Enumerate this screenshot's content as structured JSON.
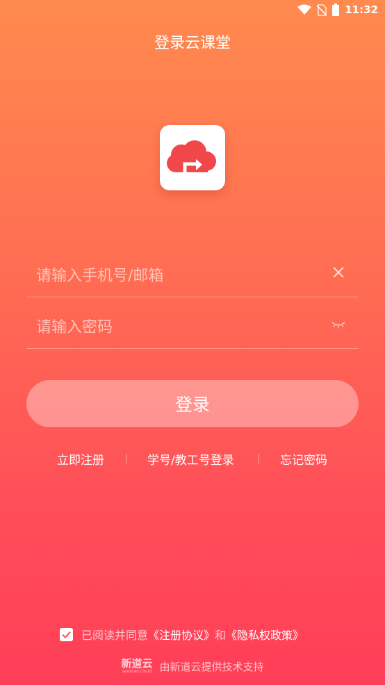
{
  "status_bar": {
    "time": "11:32",
    "icons": [
      "wifi-icon",
      "no-sim-icon",
      "battery-icon"
    ]
  },
  "header": {
    "title": "登录云课堂"
  },
  "logo": {
    "icon": "cloud-logo-icon"
  },
  "form": {
    "phone_placeholder": "请输入手机号/邮箱",
    "password_placeholder": "请输入密码",
    "login_label": "登录"
  },
  "links": {
    "register": "立即注册",
    "student_login": "学号/教工号登录",
    "forgot_password": "忘记密码"
  },
  "agreement": {
    "checked": true,
    "prefix": "已阅读并同意",
    "terms": "《注册协议》",
    "and": "和",
    "privacy": "《隐私权政策》"
  },
  "footer": {
    "logo_name": "新道云",
    "logo_sub": "seentao cloud",
    "text": "由新道云提供技术支持"
  },
  "colors": {
    "gradient_top": "#ff8a4e",
    "gradient_bottom": "#ff3e58",
    "logo_red": "#f0474a"
  }
}
